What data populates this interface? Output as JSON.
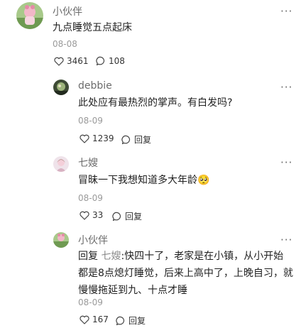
{
  "comments": [
    {
      "name": "小伙伴",
      "text": "九点睡觉五点起床",
      "date": "08-08",
      "likes": "3461",
      "replies": "108",
      "more": "···"
    },
    {
      "name": "debbie",
      "text": "此处应有最热烈的掌声。有白发吗?",
      "date": "08-09",
      "likes": "1239",
      "reply_label": "回复",
      "more": "···"
    },
    {
      "name": "七嫂",
      "text": "冒昧一下我想知道多大年龄",
      "emoji": "🥺",
      "date": "08-09",
      "likes": "33",
      "reply_label": "回复",
      "more": "···"
    },
    {
      "name": "小伙伴",
      "reply_prefix": "回复",
      "reply_to": "七嫂",
      "text_line1": ":快四十了，老家是在小镇，从小开始",
      "text_line2": "都是8点熄灯睡觉，后来上高中了，上晚自习，就",
      "text_line3": "慢慢拖延到九、十点才睡",
      "date": "08-09",
      "likes": "167",
      "reply_label": "回复",
      "more": "···"
    }
  ]
}
